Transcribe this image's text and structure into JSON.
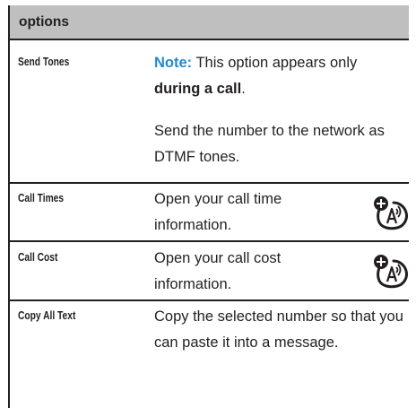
{
  "header": {
    "title": "options"
  },
  "rows": [
    {
      "label": "Send Tones",
      "note_label": "Note:",
      "note_text": " This option appears only ",
      "note_bold": "during a call",
      "note_end": ".",
      "description": "Send the number to the network as DTMF tones."
    },
    {
      "label": "Call Times",
      "description": "Open your call time information.",
      "icon": "network-dependent-icon"
    },
    {
      "label": "Call Cost",
      "description": "Open your call cost information.",
      "icon": "network-dependent-icon"
    },
    {
      "label": "Copy All Text",
      "description": "Copy the selected number so that you can paste it into a message."
    }
  ],
  "colors": {
    "header_bg": "#bfbfbf",
    "rule": "#231f20",
    "note_accent": "#1e8bd1"
  }
}
